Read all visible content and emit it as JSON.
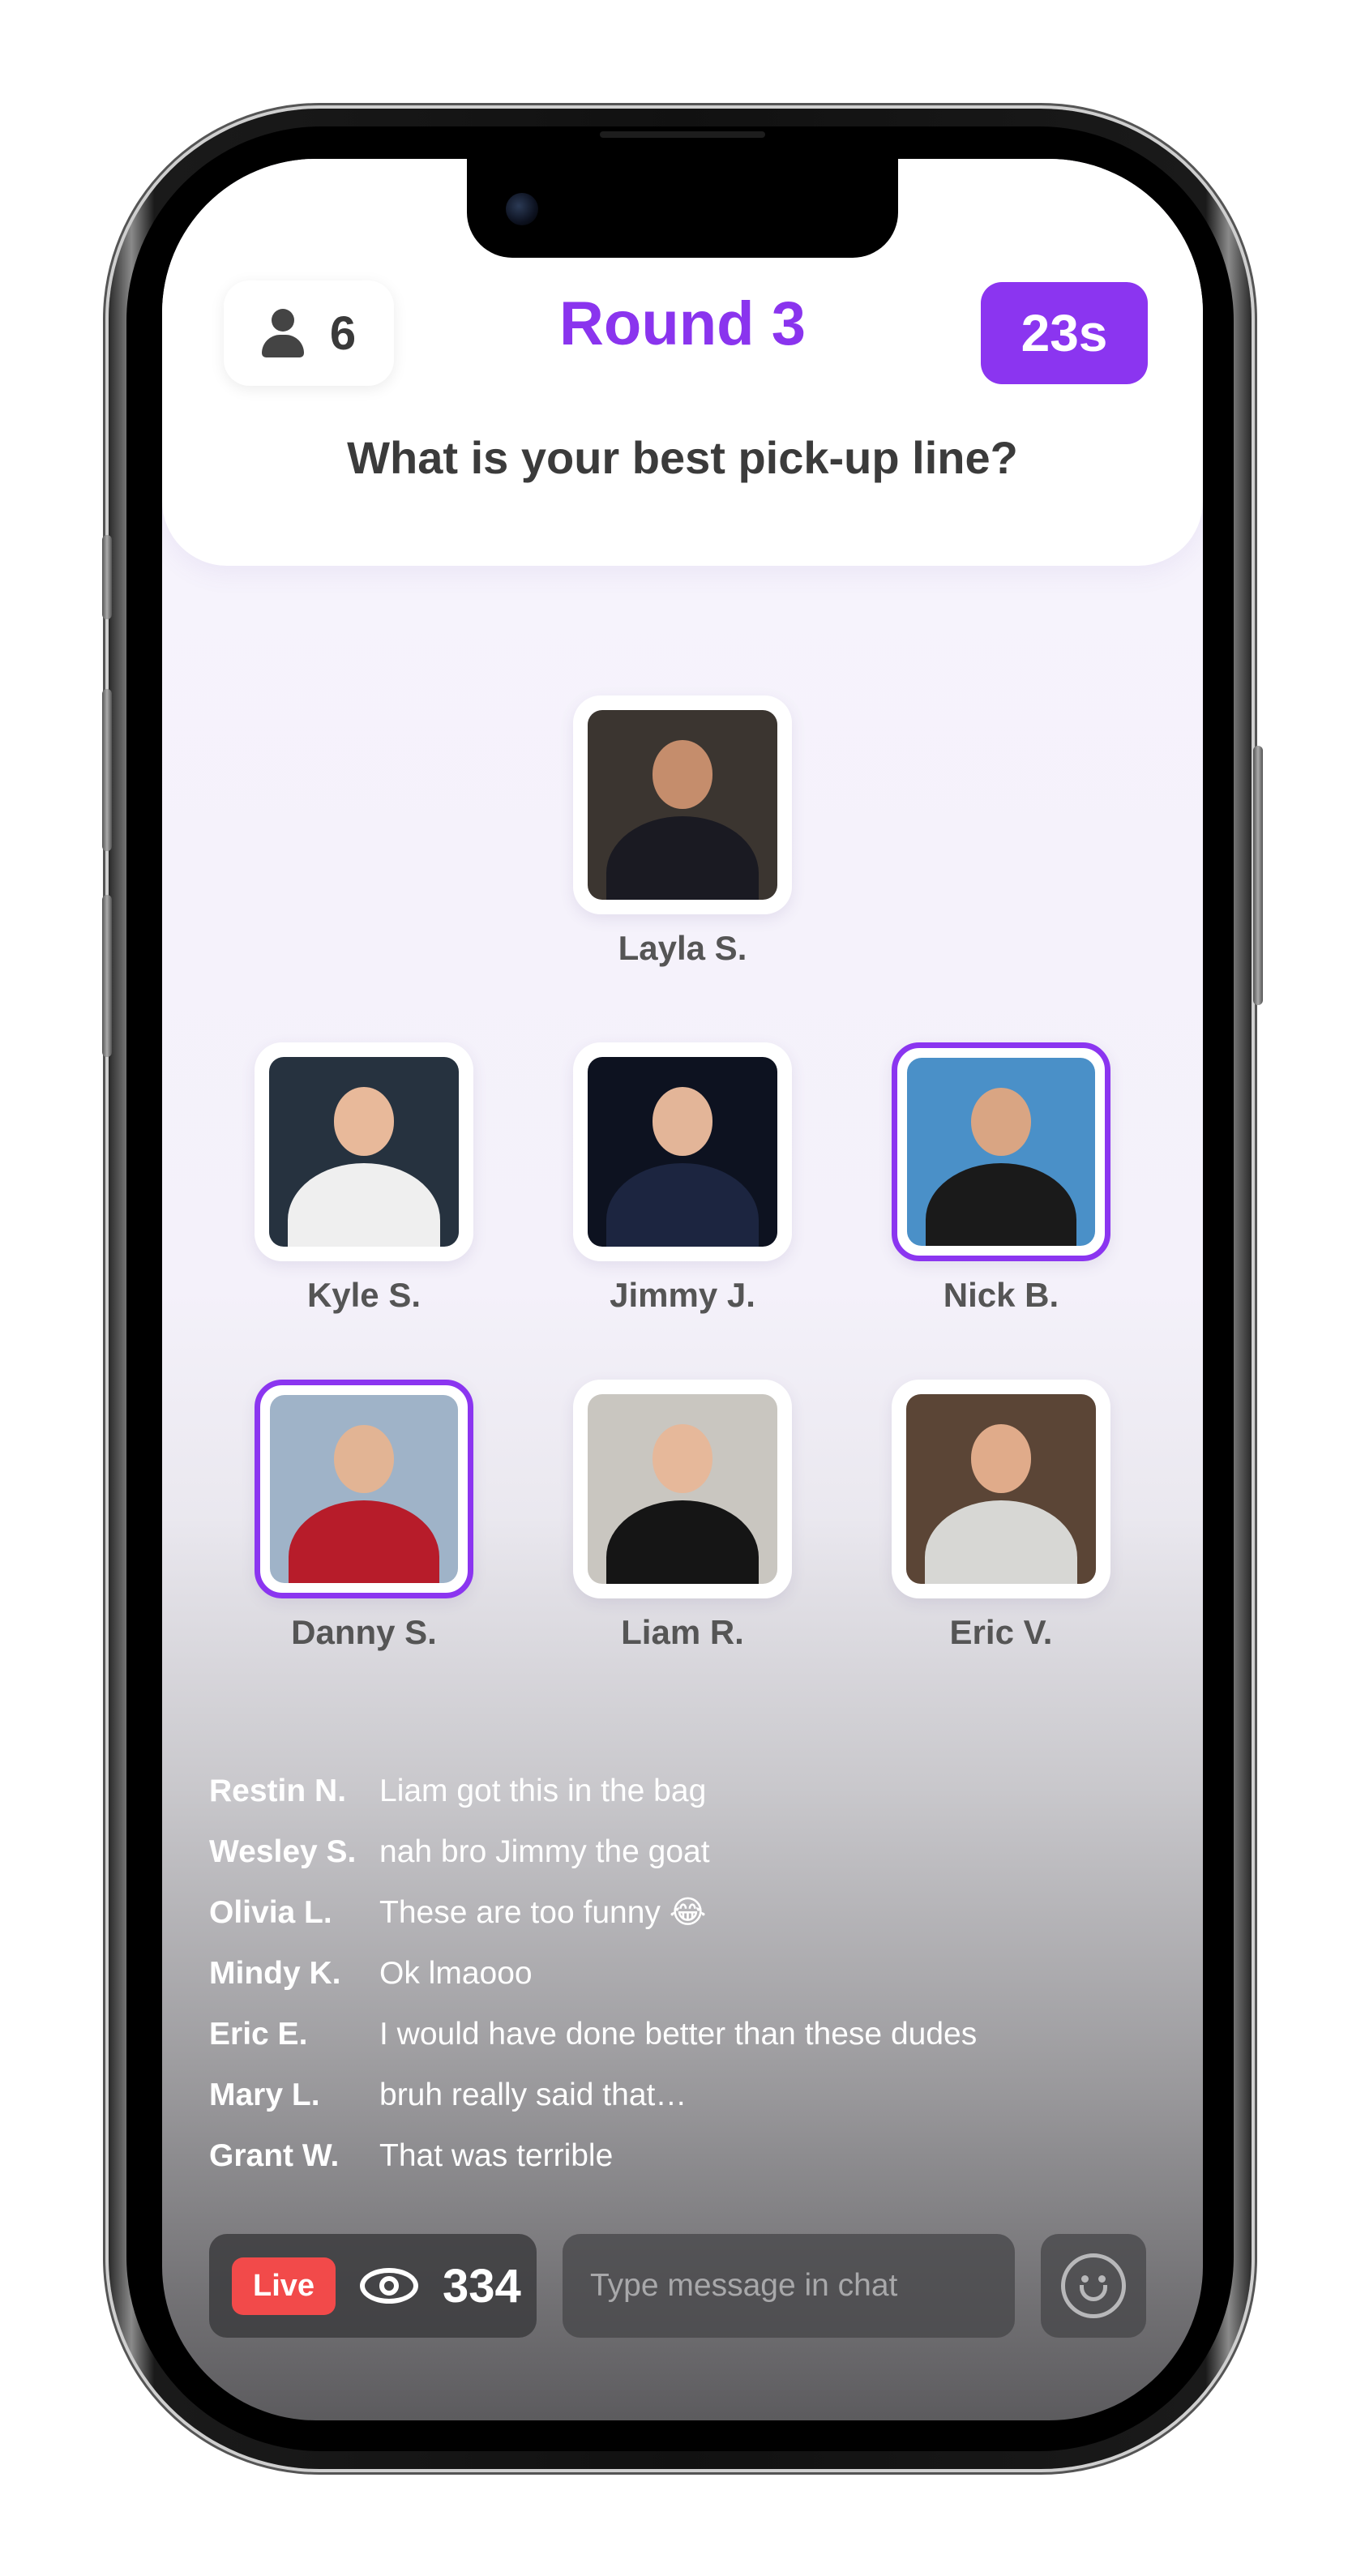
{
  "header": {
    "players_count": "6",
    "round_title": "Round 3",
    "timer": "23s",
    "question": "What is your best pick-up line?"
  },
  "players": [
    {
      "name": "Layla S.",
      "selected": false,
      "bg": "#3b3530",
      "face": "#c58d6c",
      "torso": "#1a1a22"
    },
    {
      "name": "Kyle S.",
      "selected": false,
      "bg": "#26323f",
      "face": "#e8b99a",
      "torso": "#efefef"
    },
    {
      "name": "Jimmy J.",
      "selected": false,
      "bg": "#0d1220",
      "face": "#e3b598",
      "torso": "#1c2540"
    },
    {
      "name": "Nick B.",
      "selected": true,
      "bg": "#4a90c8",
      "face": "#d9a583",
      "torso": "#1a1a1a"
    },
    {
      "name": "Danny S.",
      "selected": true,
      "bg": "#9fb3c8",
      "face": "#e2b494",
      "torso": "#b71c2a"
    },
    {
      "name": "Liam R.",
      "selected": false,
      "bg": "#c9c6c0",
      "face": "#e6b89a",
      "torso": "#151515"
    },
    {
      "name": "Eric V.",
      "selected": false,
      "bg": "#5b4536",
      "face": "#e0ab8a",
      "torso": "#d7d7d4"
    }
  ],
  "chat": [
    {
      "user": "Restin N.",
      "message": "Liam got this in the bag"
    },
    {
      "user": "Wesley S.",
      "message": "nah bro Jimmy the goat"
    },
    {
      "user": "Olivia L.",
      "message": "These are too funny 😂"
    },
    {
      "user": "Mindy K.",
      "message": "Ok lmaooo"
    },
    {
      "user": "Eric E.",
      "message": "I would have done better than these dudes"
    },
    {
      "user": "Mary L.",
      "message": "bruh really said that…"
    },
    {
      "user": "Grant W.",
      "message": "That was terrible"
    }
  ],
  "footer": {
    "live_label": "Live",
    "viewer_count": "334",
    "chat_placeholder": "Type message in chat"
  },
  "icons": {
    "players": "person-icon",
    "viewers": "eye-icon",
    "emoji": "smiley-icon"
  },
  "colors": {
    "accent": "#8b35f0",
    "live": "#f24a4a",
    "question_text": "#3b3b3b"
  }
}
